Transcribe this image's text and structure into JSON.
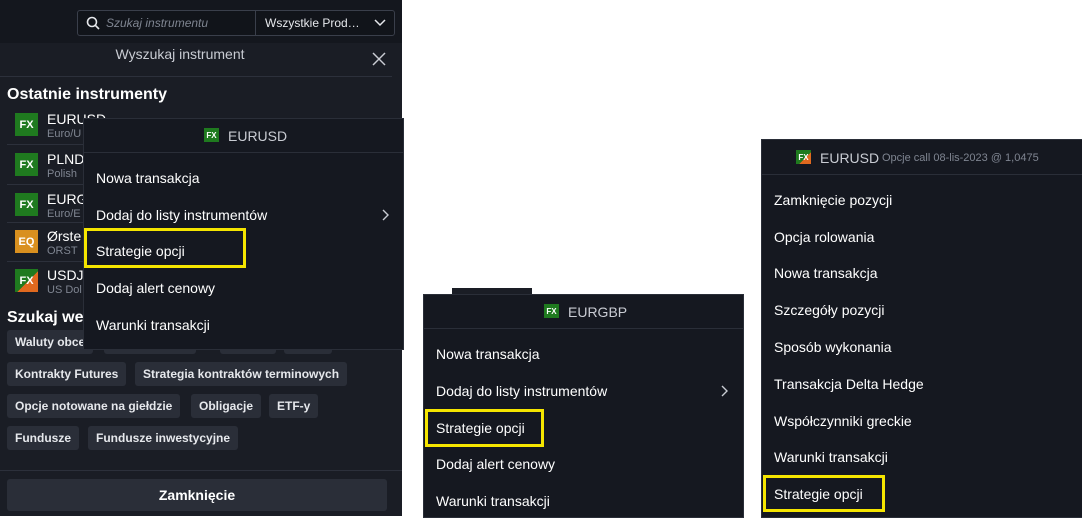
{
  "left_panel": {
    "search_placeholder": "Szukaj instrumentu",
    "product_filter": "Wszystkie Prod…",
    "dialog_title": "Wyszukaj instrument",
    "recent_title": "Ostatnie instrumenty",
    "recent": [
      {
        "badge": "FX",
        "name": "EURUSD",
        "sub": "Euro/U",
        "color": "#1f7a1f"
      },
      {
        "badge": "FX",
        "name": "PLND",
        "sub": "Polish",
        "color": "#1f7a1f"
      },
      {
        "badge": "FX",
        "name": "EURG",
        "sub": "Euro/E",
        "color": "#1f7a1f"
      },
      {
        "badge": "EQ",
        "name": "Ørste",
        "sub": "ORST",
        "color": "#d9901f"
      },
      {
        "badge": "FX",
        "name": "USDJ",
        "sub": "US Dol",
        "color": "#1f7a1f"
      }
    ],
    "search_in_title": "Szukaj we",
    "chips_row1": [
      "Waluty obce"
    ],
    "chips_row2": [
      "Kontrakty Futures",
      "Strategia kontraktów terminowych"
    ],
    "chips_row3": [
      "Opcje notowane na giełdzie",
      "Obligacje",
      "ETF-y"
    ],
    "chips_row4": [
      "Fundusze",
      "Fundusze inwestycyjne"
    ],
    "close_label": "Zamknięcie"
  },
  "menu1": {
    "badge": "FX",
    "title": "EURUSD",
    "items": [
      "Nowa transakcja",
      "Dodaj do listy instrumentów",
      "Strategie opcji",
      "Dodaj alert cenowy",
      "Warunki transakcji"
    ]
  },
  "menu2": {
    "badge": "FX",
    "title": "EURGBP",
    "items": [
      "Nowa transakcja",
      "Dodaj do listy instrumentów",
      "Strategie opcji",
      "Dodaj alert cenowy",
      "Warunki transakcji"
    ]
  },
  "menu3": {
    "badge": "FX",
    "title": "EURUSD",
    "subtitle": "Opcje call 08-lis-2023 @ 1,0475",
    "items": [
      "Zamknięcie pozycji",
      "Opcja rolowania",
      "Nowa transakcja",
      "Szczegóły pozycji",
      "Sposób wykonania",
      "Transakcja Delta Hedge",
      "Współczynniki greckie",
      "Warunki transakcji",
      "Strategie opcji"
    ]
  },
  "colors": {
    "highlight": "#f5e500",
    "fx_green": "#1f7a1f",
    "eq_orange": "#d9901f",
    "panel_bg": "#1a1d25"
  }
}
